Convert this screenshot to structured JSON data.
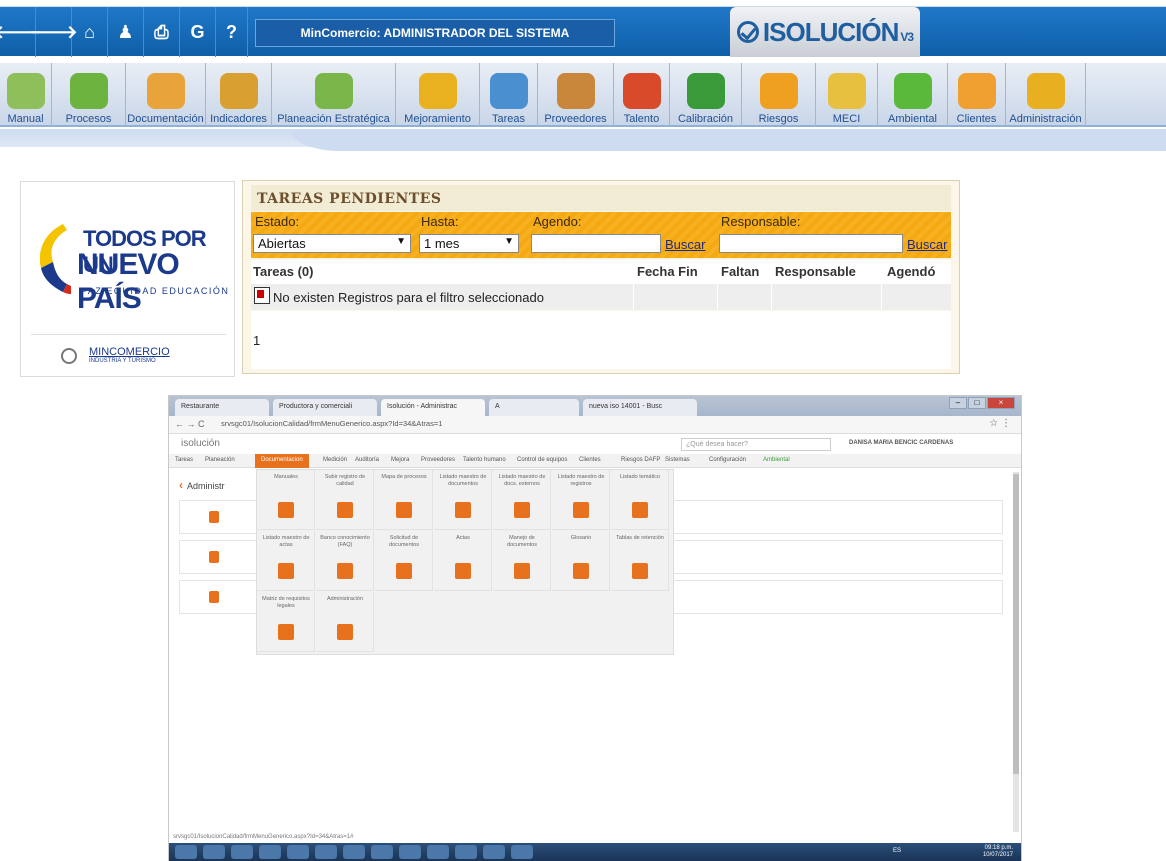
{
  "top": {
    "nav_icons": [
      "back-arrow-icon",
      "forward-arrow-icon",
      "home-icon",
      "user-icon",
      "print-icon",
      "google-icon",
      "help-icon"
    ],
    "nav_glyphs": [
      "🡐",
      "🡒",
      "⌂",
      "♟",
      "⎙",
      "G",
      "?"
    ],
    "system_title": "MinComercio: ADMINISTRADOR DEL SISTEMA",
    "logo_text": "ISOLUCIÓN",
    "logo_version": "V3",
    "modules": [
      {
        "label": "Manual",
        "color": "#8fbf5a"
      },
      {
        "label": "Procesos",
        "color": "#6cb33f"
      },
      {
        "label": "Documentación",
        "color": "#e8a43a"
      },
      {
        "label": "Indicadores",
        "color": "#d8a030"
      },
      {
        "label": "Planeación Estratégica",
        "color": "#7ab64a"
      },
      {
        "label": "Mejoramiento",
        "color": "#e9b020"
      },
      {
        "label": "Tareas",
        "color": "#4a8fd0"
      },
      {
        "label": "Proveedores",
        "color": "#c8873a"
      },
      {
        "label": "Talento",
        "color": "#d84a2a"
      },
      {
        "label": "Calibración",
        "color": "#3a9a3a"
      },
      {
        "label": "Riesgos",
        "color": "#f0a020"
      },
      {
        "label": "MECI",
        "color": "#e8c040"
      },
      {
        "label": "Ambiental",
        "color": "#5ab83a"
      },
      {
        "label": "Clientes",
        "color": "#f0a030"
      },
      {
        "label": "Administración",
        "color": "#e8b020"
      }
    ],
    "module_widths": [
      52,
      74,
      80,
      66,
      124,
      84,
      58,
      76,
      56,
      72,
      74,
      62,
      70,
      58,
      80
    ]
  },
  "brand": {
    "line1": "TODOS POR UN",
    "line2": "NUEVO PAÍS",
    "line3": "PAZ  EQUIDAD  EDUCACIÓN",
    "ministry": "MINCOMERCIO",
    "ministry_sub": "INDUSTRIA Y TURISMO"
  },
  "tareas": {
    "title": "TAREAS PENDIENTES",
    "estado_label": "Estado:",
    "estado_value": "Abiertas",
    "hasta_label": "Hasta:",
    "hasta_value": "1 mes",
    "agendo_label": "Agendo:",
    "buscar1": "Buscar",
    "responsable_label": "Responsable:",
    "buscar2": "Buscar",
    "col_tareas": "Tareas (0)",
    "col_fecha": "Fecha Fin",
    "col_faltan": "Faltan",
    "col_responsable": "Responsable",
    "col_agendo": "Agendó",
    "empty_msg": "No existen Registros para el filtro seleccionado",
    "page": "1"
  },
  "browser": {
    "tabs": [
      "Restaurante",
      "Productora y comerciali",
      "Isolución - Administrac",
      "A",
      "nueva iso 14001 - Busc"
    ],
    "url": "srvsgc01/IsolucionCalidad/frmMenuGenerico.aspx?Id=34&Atras=1",
    "logo": "isolución",
    "search_placeholder": "¿Qué desea hacer?",
    "user": "DANISA MARIA BENCIC CARDENAS",
    "menu": [
      "Tareas",
      "Planeación",
      "Documentacion",
      "Medición",
      "Auditoría",
      "Mejora",
      "Proveedores",
      "Talento humano",
      "Control de equipos",
      "Clientes",
      "Riesgos DAFP",
      "Sistemas",
      "Configuración",
      "Ambiental"
    ],
    "breadcrumb": "Administr",
    "dropdown": [
      "Manuales",
      "Subir registro de calidad",
      "Mapa de procesos",
      "Listado maestro de documentos",
      "Listado maestro de docs. externos",
      "Listado maestro de registros",
      "Listado temático",
      "Listado maestro de actas",
      "Banco conocimiento (FAQ)",
      "Solicitud de documentos",
      "Actas",
      "Manejo de documentos",
      "Glosario",
      "Tablas de retención",
      "Matriz de requisitos legales",
      "Administración"
    ],
    "status_url": "srvsgc01/IsolucionCalidad/frmMenuGenerico.aspx?Id=34&Atras=1#",
    "lang": "ES",
    "time": "09:18 p.m.",
    "date": "10/07/2017"
  }
}
